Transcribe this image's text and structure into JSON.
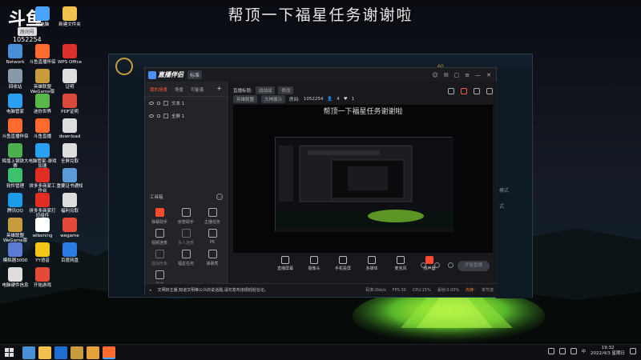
{
  "overlay_title": "帮顶一下福星任务谢谢啦",
  "stream_overlay": {
    "logo_text": "斗鱼",
    "badge": "房间号",
    "room_id": "1052254"
  },
  "desktop_icons": [
    {
      "label": "此电脑",
      "color": "#4aa3ff"
    },
    {
      "label": "新建文件夹",
      "color": "#f2c14e"
    },
    {
      "label": "Network",
      "color": "#4a90d9"
    },
    {
      "label": "斗鱼直播伴侣",
      "color": "#ff6a2f"
    },
    {
      "label": "WPS Office",
      "color": "#d9302c"
    },
    {
      "label": "回收站",
      "color": "#8899aa"
    },
    {
      "label": "英雄联盟 WeGame版",
      "color": "#c89b3c"
    },
    {
      "label": "证明",
      "color": "#dddddd"
    },
    {
      "label": "电脑管家",
      "color": "#2aa1f0"
    },
    {
      "label": "迷你世界",
      "color": "#57b847"
    },
    {
      "label": "PDF证明",
      "color": "#d94a3a"
    },
    {
      "label": "斗鱼直播伴侣",
      "color": "#ff6a2f"
    },
    {
      "label": "斗鱼直播",
      "color": "#ff6a2f"
    },
    {
      "label": "download",
      "color": "#dddddd"
    },
    {
      "label": "辉煌上钢铁大赛",
      "color": "#4caf50"
    },
    {
      "label": "电脑管家-游戏加速",
      "color": "#2aa1f0"
    },
    {
      "label": "全屏兑取",
      "color": "#dddddd"
    },
    {
      "label": "软件管理",
      "color": "#3ec06e"
    },
    {
      "label": "拼多多商家工作台",
      "color": "#e02e24"
    },
    {
      "label": "重要证书通知",
      "color": "#5b9bd5"
    },
    {
      "label": "腾讯QQ",
      "color": "#1e9be8"
    },
    {
      "label": "拼多多商家打印组件",
      "color": "#e02e24"
    },
    {
      "label": "福利兑取",
      "color": "#dddddd"
    },
    {
      "label": "英雄联盟 WeGame版",
      "color": "#c89b3c"
    },
    {
      "label": "wlbening",
      "color": "#ffffff"
    },
    {
      "label": "wegame",
      "color": "#e44a3a"
    },
    {
      "label": "模拟器3000",
      "color": "#5b7bd5"
    },
    {
      "label": "YY语音",
      "color": "#f5c518"
    },
    {
      "label": "百度网盘",
      "color": "#2b7be4"
    },
    {
      "label": "电脑硬件信息",
      "color": "#dddddd"
    },
    {
      "label": "开始游戏",
      "color": "#e44a3a"
    }
  ],
  "lol_client": {
    "side_labels": [
      "模式",
      "式"
    ],
    "stat": "60"
  },
  "app": {
    "title": "直播伴侣",
    "tag": "标准",
    "window_controls": [
      "☺",
      "✉",
      "▢",
      "≡",
      "—",
      "✕"
    ],
    "left_tabs": [
      "我的场景",
      "场景",
      "可能客"
    ],
    "scenes": [
      "文本 1",
      "全屏 1"
    ],
    "tools_title": "工具箱",
    "tools": [
      {
        "label": "弹幕助手",
        "active": true
      },
      {
        "label": "房管助手",
        "active": false
      },
      {
        "label": "主播任务",
        "active": false
      },
      {
        "label": "视频连麦",
        "active": false
      },
      {
        "label": "多人连麦",
        "active": false,
        "dim": true
      },
      {
        "label": "PK",
        "active": false
      },
      {
        "label": "虚拟形象",
        "active": false,
        "dim": true
      },
      {
        "label": "福星任务",
        "active": false
      },
      {
        "label": "弹幕秀",
        "active": false
      },
      {
        "label": "活动",
        "active": false
      }
    ],
    "info": {
      "title_label": "直播标题:",
      "title_value": "战战战",
      "category_label": "修改",
      "game": "英雄联盟",
      "sub": "大神展示",
      "room_label": "房间:",
      "room_id": "1052254",
      "viewers": "4",
      "fans": "1"
    },
    "preview_title": "帮顶一下福星任务谢谢啦",
    "bottom_tools": [
      {
        "label": "直播屏幕",
        "red": false
      },
      {
        "label": "摄像头",
        "red": false
      },
      {
        "label": "手机投屏",
        "red": false
      },
      {
        "label": "多媒体",
        "red": false
      },
      {
        "label": "麦克风",
        "red": false
      },
      {
        "label": "扬声器",
        "red": true
      }
    ],
    "live_button": "开始直播",
    "status": {
      "notice_icon": "speaker-icon",
      "notice": "文明转主播,知道文明等公众的说话题,请勿发布违规低俗言论。",
      "bitrate": "码率:0kb/s",
      "fps": "FPS:30",
      "cpu": "CPU:15%",
      "drop": "丢帧:0.00%",
      "mem": "内存:",
      "limit": "单节流"
    }
  },
  "taskbar": {
    "time": "19:32",
    "date": "2022/4/3 星期日",
    "ime": "中",
    "apps": [
      "#4a90d9",
      "#f2c14e",
      "#1e6fd1",
      "#c89b3c",
      "#e8a03a",
      "#ff6a2f"
    ]
  }
}
